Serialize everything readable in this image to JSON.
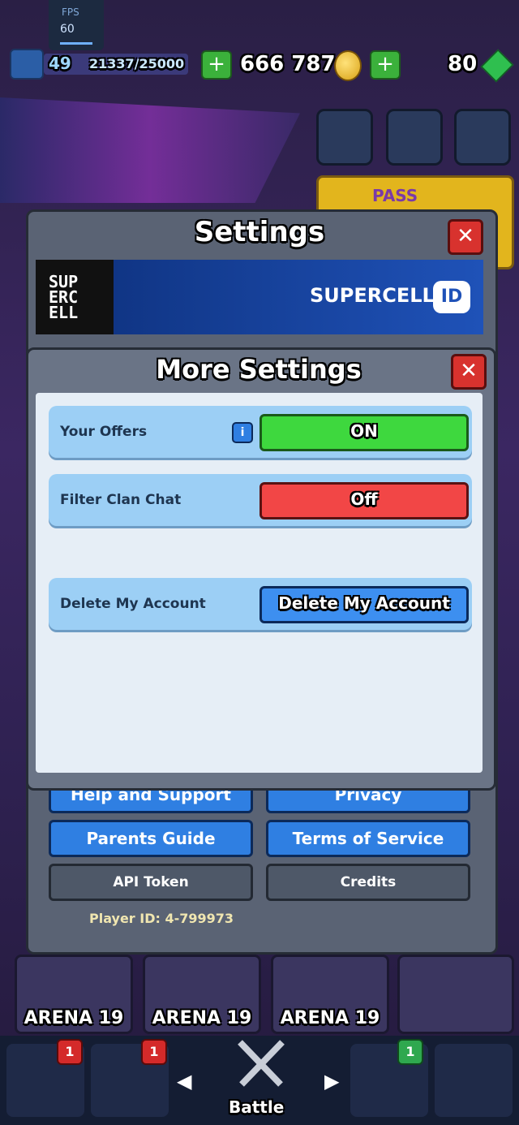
{
  "fps": {
    "label": "FPS",
    "value": "60"
  },
  "topbar": {
    "level": "49",
    "xp": "21337/25000",
    "gold": "666 787",
    "gems": "80"
  },
  "pass": {
    "label": "PASS"
  },
  "settings": {
    "title": "Settings",
    "supercell_id": "SUPERCELL",
    "supercell_badge": "ID",
    "logo": "SUP\nERC\nELL",
    "buttons": {
      "help": "Help and Support",
      "privacy": "Privacy",
      "parents": "Parents Guide",
      "terms": "Terms of Service",
      "api": "API Token",
      "credits": "Credits"
    },
    "player_id": "Player ID: 4-799973"
  },
  "more": {
    "title": "More Settings",
    "rows": [
      {
        "label": "Your Offers",
        "value": "ON"
      },
      {
        "label": "Filter Clan Chat",
        "value": "Off"
      },
      {
        "label": "Delete My Account",
        "value": "Delete My Account"
      }
    ]
  },
  "arena_cards": [
    "ARENA 19",
    "ARENA 19",
    "ARENA 19"
  ],
  "nav": {
    "battle": "Battle",
    "badges": [
      "1",
      "1",
      "1"
    ]
  },
  "colors": {
    "on": "#3ed83e",
    "off": "#f24646",
    "close": "#d8322e",
    "accent": "#2f7fe2"
  }
}
